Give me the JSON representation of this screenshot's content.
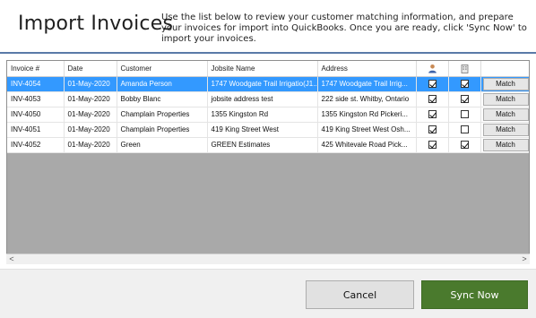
{
  "header": {
    "title": "Import Invoices",
    "instructions": "Use the list below to review your customer matching information, and prepare your invoices for import into QuickBooks.  Once you are ready, click 'Sync Now' to import your invoices."
  },
  "grid": {
    "columns": [
      "Invoice #",
      "Date",
      "Customer",
      "Jobsite Name",
      "Address"
    ],
    "icon_columns": [
      "person-icon",
      "building-icon"
    ],
    "rows": [
      {
        "invoice": "INV-4054",
        "date": "01-May-2020",
        "customer": "Amanda Person",
        "jobsite": "1747 Woodgate Trail Irrigatio(J1...",
        "address": "1747 Woodgate Trail Irrig...",
        "customer_checked": true,
        "jobsite_checked": true,
        "action": "Match"
      },
      {
        "invoice": "INV-4053",
        "date": "01-May-2020",
        "customer": "Bobby Blanc",
        "jobsite": "jobsite address test",
        "address": "222 side st. Whitby, Ontario",
        "customer_checked": true,
        "jobsite_checked": true,
        "action": "Match"
      },
      {
        "invoice": "INV-4050",
        "date": "01-May-2020",
        "customer": "Champlain Properties",
        "jobsite": "1355 Kingston Rd",
        "address": "1355 Kingston Rd Pickeri...",
        "customer_checked": true,
        "jobsite_checked": false,
        "action": "Match"
      },
      {
        "invoice": "INV-4051",
        "date": "01-May-2020",
        "customer": "Champlain Properties",
        "jobsite": "419 King Street West",
        "address": "419 King Street West Osh...",
        "customer_checked": true,
        "jobsite_checked": false,
        "action": "Match"
      },
      {
        "invoice": "INV-4052",
        "date": "01-May-2020",
        "customer": "Green",
        "jobsite": "GREEN Estimates",
        "address": "425 Whitevale Road Pick...",
        "customer_checked": true,
        "jobsite_checked": true,
        "action": "Match"
      }
    ],
    "selected_row": 0
  },
  "scrollbar": {
    "left_arrow": "<",
    "right_arrow": ">"
  },
  "footer": {
    "cancel_label": "Cancel",
    "sync_label": "Sync Now"
  },
  "colors": {
    "selection": "#3399ff",
    "sync_button": "#4a7a2d",
    "header_rule": "#5a7aa8"
  }
}
